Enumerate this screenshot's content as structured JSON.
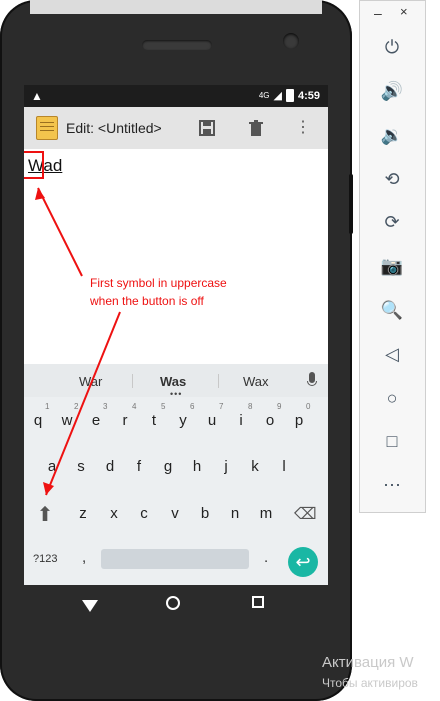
{
  "statusbar": {
    "time": "4:59",
    "network": "4G"
  },
  "actionbar": {
    "title": "Edit: <Untitled>"
  },
  "editor": {
    "text": "Wad"
  },
  "keyboard": {
    "suggestions": [
      "War",
      "Was",
      "Wax"
    ],
    "rows": [
      [
        "q",
        "w",
        "e",
        "r",
        "t",
        "y",
        "u",
        "i",
        "o",
        "p"
      ],
      [
        "a",
        "s",
        "d",
        "f",
        "g",
        "h",
        "j",
        "k",
        "l"
      ],
      [
        "z",
        "x",
        "c",
        "v",
        "b",
        "n",
        "m"
      ]
    ],
    "numbers": [
      "1",
      "2",
      "3",
      "4",
      "5",
      "6",
      "7",
      "8",
      "9",
      "0"
    ],
    "symbols_label": "?123",
    "comma_label": ",",
    "period_label": ".",
    "enter_label": "↩"
  },
  "annotation": {
    "line1": "First symbol in uppercase",
    "line2": "when the button is off"
  },
  "emulator_toolbar": {
    "minimize": "–",
    "close": "×",
    "buttons": [
      "power-icon",
      "volume-up-icon",
      "volume-down-icon",
      "rotate-left-icon",
      "rotate-right-icon",
      "camera-icon",
      "zoom-icon",
      "back-icon",
      "home-icon",
      "overview-icon",
      "more-icon"
    ]
  },
  "watermark": {
    "line1": "Активация W",
    "line2": "Чтобы активиров"
  },
  "colors": {
    "accent": "#1ab7a4",
    "annotation": "#e11111",
    "keyboard_bg": "#eceff1"
  }
}
